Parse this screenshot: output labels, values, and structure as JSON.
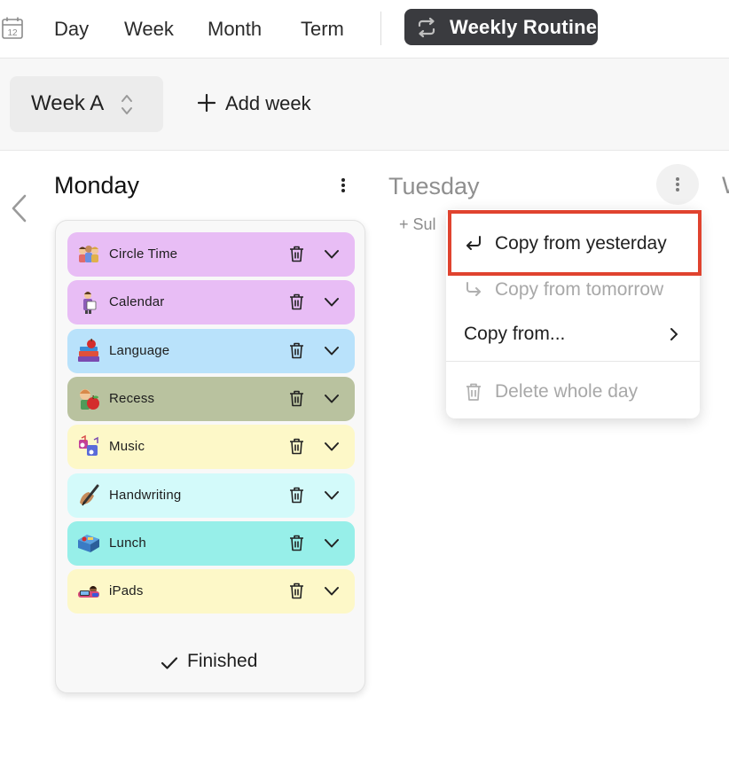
{
  "topnav": {
    "calendar_day": "12",
    "tabs": [
      {
        "label": "Day"
      },
      {
        "label": "Week"
      },
      {
        "label": "Month"
      },
      {
        "label": "Term"
      }
    ],
    "routine_button": "Weekly Routine"
  },
  "weekbar": {
    "week_selector": "Week A",
    "add_week": "Add week"
  },
  "days": {
    "monday": {
      "title": "Monday",
      "subjects": [
        {
          "name": "Circle Time",
          "color": "#e8bdf5",
          "icon": "children-group-icon"
        },
        {
          "name": "Calendar",
          "color": "#e8bdf5",
          "icon": "teacher-calendar-icon"
        },
        {
          "name": "Language",
          "color": "#b9e2fb",
          "icon": "books-apple-icon"
        },
        {
          "name": "Recess",
          "color": "#b9c29f",
          "icon": "child-apple-icon"
        },
        {
          "name": "Music",
          "color": "#fdf8c8",
          "icon": "music-notes-icon"
        },
        {
          "name": "Handwriting",
          "color": "#d3fafa",
          "icon": "hand-pencil-icon"
        },
        {
          "name": "Lunch",
          "color": "#97efe9",
          "icon": "lunchbox-icon"
        },
        {
          "name": "iPads",
          "color": "#fdf8c8",
          "icon": "child-tablet-icon"
        }
      ],
      "finished": "Finished"
    },
    "tuesday": {
      "title": "Tuesday",
      "add_subject": "+ Sul"
    },
    "wednesday_partial": "W"
  },
  "context_menu": {
    "copy_from_yesterday": "Copy from yesterday",
    "copy_from_tomorrow": "Copy from tomorrow",
    "copy_from": "Copy from...",
    "delete_whole_day": "Delete whole day"
  },
  "colors": {
    "highlight": "#e0432f",
    "routine_button_bg": "#3a3b3f"
  }
}
